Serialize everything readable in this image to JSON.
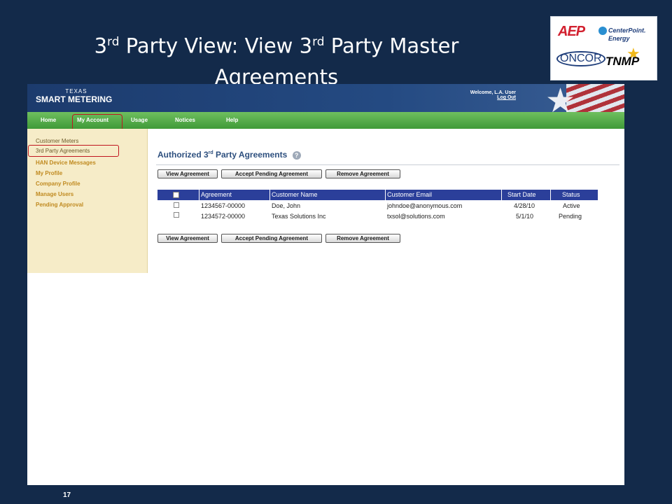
{
  "slide": {
    "title_part1": "3",
    "title_sup1": "rd",
    "title_part2": " Party View:  View 3",
    "title_sup2": "rd",
    "title_part3": " Party Master",
    "title_line2": "Agreements",
    "page_number": "17"
  },
  "logos": {
    "aep": "AEP",
    "centerpoint_line1": "CenterPoint.",
    "centerpoint_line2": "Energy",
    "oncor": "ONCOR",
    "tnmp": "TNMP"
  },
  "header": {
    "brand_small": "TEXAS",
    "brand_big": "SMART METERING",
    "welcome": "Welcome, L.A. User",
    "logout": "Log Out"
  },
  "nav": {
    "tabs": [
      {
        "label": "Home"
      },
      {
        "label": "My Account"
      },
      {
        "label": "Usage"
      },
      {
        "label": "Notices"
      },
      {
        "label": "Help"
      }
    ]
  },
  "sidebar": {
    "items": [
      {
        "label": "Customer Meters"
      },
      {
        "label": "3rd Party Agreements"
      },
      {
        "label": "HAN Device Messages"
      },
      {
        "label": "My Profile"
      },
      {
        "label": "Company Profile"
      },
      {
        "label": "Manage Users"
      },
      {
        "label": "Pending Approval"
      }
    ]
  },
  "content": {
    "title_part1": "Authorized 3",
    "title_sup": "rd",
    "title_part2": " Party Agreements",
    "help": "?"
  },
  "buttons": {
    "view": "View Agreement",
    "accept": "Accept Pending Agreement",
    "remove": "Remove Agreement"
  },
  "table": {
    "columns": [
      "Agreement",
      "Customer Name",
      "Customer Email",
      "Start Date",
      "Status"
    ],
    "rows": [
      {
        "agreement": "1234567-00000",
        "name": "Doe, John",
        "email": "johndoe@anonymous.com",
        "start": "4/28/10",
        "status": "Active"
      },
      {
        "agreement": "1234572-00000",
        "name": "Texas Solutions Inc",
        "email": "txsol@solutions.com",
        "start": "5/1/10",
        "status": "Pending"
      }
    ]
  },
  "colors": {
    "slide_bg": "#132a4a",
    "header_blue": "#1c3b6d",
    "nav_green": "#3f9a38",
    "table_header": "#2b3f9a",
    "highlight_red": "#c0151f"
  }
}
